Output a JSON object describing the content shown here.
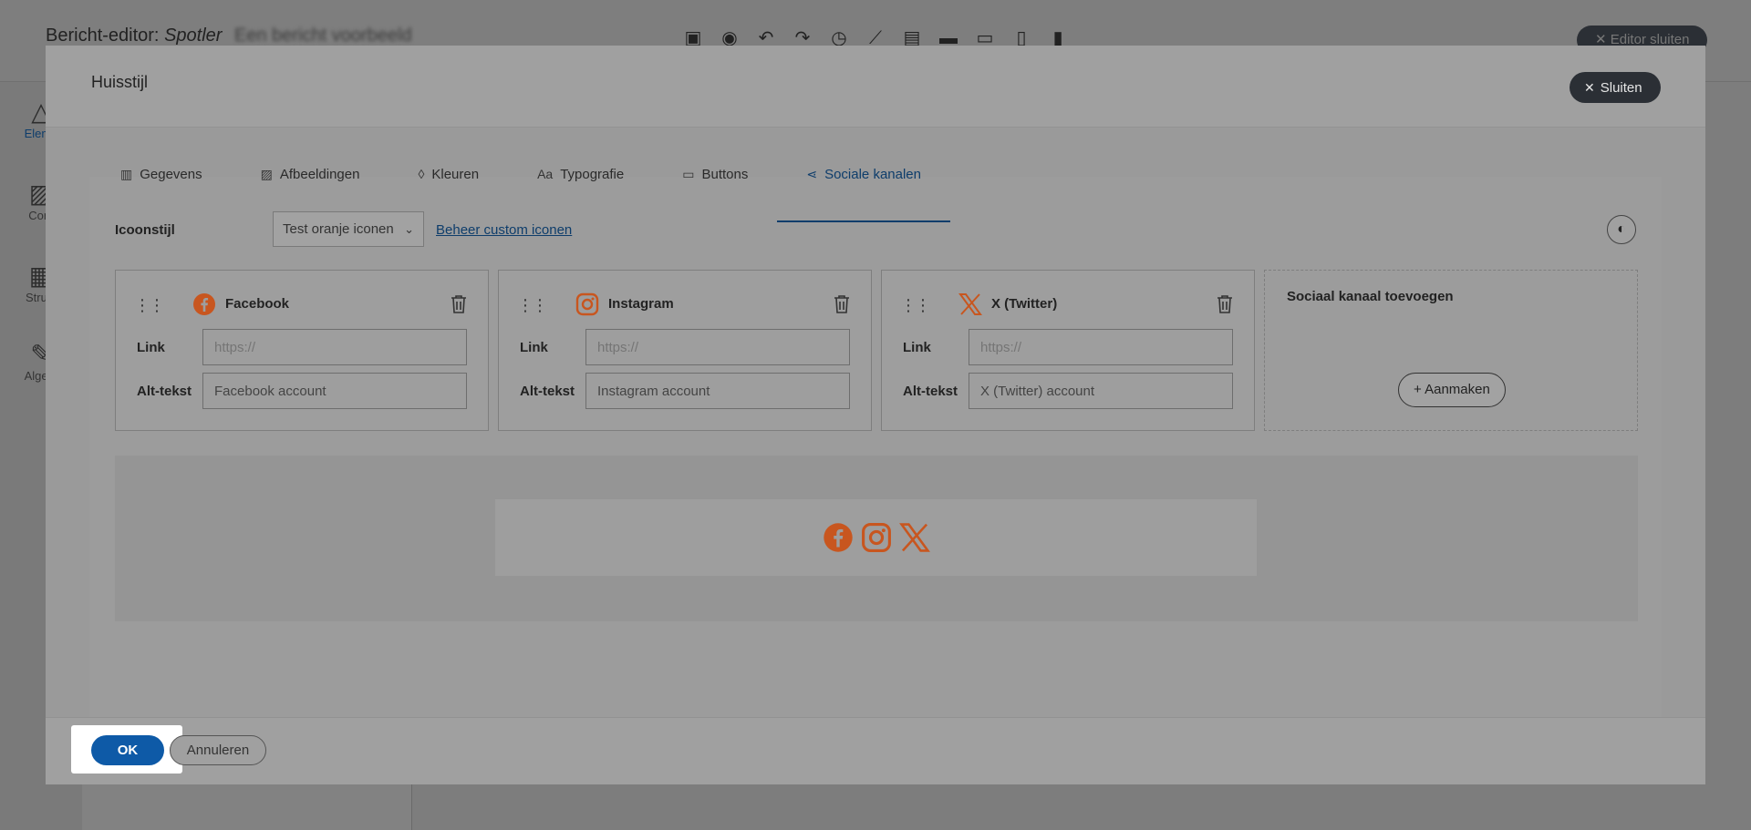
{
  "app": {
    "title_prefix": "Bericht-editor:",
    "title_name": "Spotler",
    "title_rest": "Een bericht voorbeeld",
    "close_label": "Editor sluiten",
    "sidebar": [
      "Eleme",
      "Cont",
      "Struct",
      "Algem"
    ]
  },
  "modal": {
    "title": "Huisstijl",
    "close_label": "Sluiten",
    "tabs": [
      {
        "label": "Gegevens",
        "icon": "building-icon"
      },
      {
        "label": "Afbeeldingen",
        "icon": "image-icon"
      },
      {
        "label": "Kleuren",
        "icon": "drop-icon"
      },
      {
        "label": "Typografie",
        "icon": "typography-icon"
      },
      {
        "label": "Buttons",
        "icon": "button-icon"
      },
      {
        "label": "Sociale kanalen",
        "icon": "share-icon",
        "active": true
      }
    ],
    "iconstyle_label": "Icoonstijl",
    "iconstyle_value": "Test oranje iconen",
    "manage_link": "Beheer custom iconen",
    "link_label": "Link",
    "alt_label": "Alt-tekst",
    "channels": [
      {
        "name": "Facebook",
        "icon": "facebook-icon",
        "link_placeholder": "https://",
        "alt_value": "Facebook account"
      },
      {
        "name": "Instagram",
        "icon": "instagram-icon",
        "link_placeholder": "https://",
        "alt_value": "Instagram account"
      },
      {
        "name": "X (Twitter)",
        "icon": "x-twitter-icon",
        "link_placeholder": "https://",
        "alt_value": "X (Twitter) account"
      }
    ],
    "add_card": {
      "title": "Sociaal kanaal toevoegen",
      "button": "+ Aanmaken"
    },
    "footer": {
      "ok": "OK",
      "cancel": "Annuleren"
    }
  },
  "colors": {
    "accent": "#0e3d6b",
    "ok": "#0e5aa7",
    "social": "#c8561f"
  }
}
